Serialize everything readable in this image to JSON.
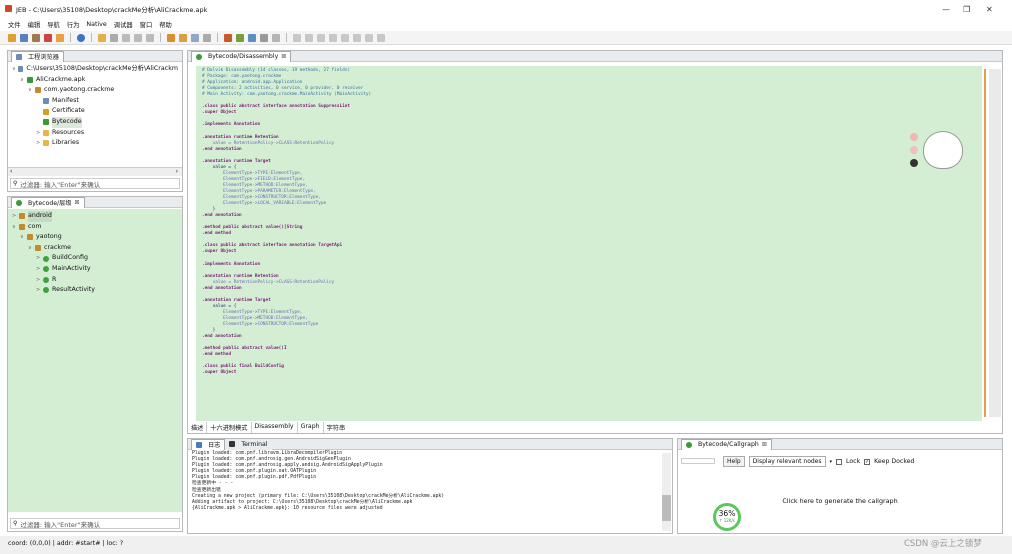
{
  "window": {
    "title": "JEB - C:\\Users\\35108\\Desktop\\crackMe分析\\AliCrackme.apk",
    "minimize": "—",
    "maximize": "❐",
    "close": "✕"
  },
  "menu": [
    "文件",
    "编辑",
    "导航",
    "行为",
    "Native",
    "调试器",
    "窗口",
    "帮助"
  ],
  "project_panel": {
    "tab": "工程浏览器",
    "items": [
      {
        "label": "C:\\Users\\35108\\Desktop\\crackMe分析\\AliCrackm",
        "depth": 0,
        "arrow": "∨"
      },
      {
        "label": "AliCrackme.apk",
        "depth": 1,
        "arrow": "∨"
      },
      {
        "label": "com.yaotong.crackme",
        "depth": 2,
        "arrow": "∨"
      },
      {
        "label": "Manifest",
        "depth": 3,
        "arrow": ""
      },
      {
        "label": "Certificate",
        "depth": 3,
        "arrow": ""
      },
      {
        "label": "Bytecode",
        "depth": 3,
        "arrow": ""
      },
      {
        "label": "Resources",
        "depth": 3,
        "arrow": ">"
      },
      {
        "label": "Libraries",
        "depth": 3,
        "arrow": ">"
      }
    ],
    "filter_placeholder": "过滤器: 输入\"Enter\"来确认"
  },
  "hierarchy_panel": {
    "tab": "Bytecode/层级",
    "items": [
      {
        "label": "android",
        "depth": 0,
        "arrow": ">"
      },
      {
        "label": "com",
        "depth": 0,
        "arrow": "∨"
      },
      {
        "label": "yaotong",
        "depth": 1,
        "arrow": "∨"
      },
      {
        "label": "crackme",
        "depth": 2,
        "arrow": "∨"
      },
      {
        "label": "BuildConfig",
        "depth": 3,
        "arrow": ">"
      },
      {
        "label": "MainActivity",
        "depth": 3,
        "arrow": ">"
      },
      {
        "label": "R",
        "depth": 3,
        "arrow": ">"
      },
      {
        "label": "ResultActivity",
        "depth": 3,
        "arrow": ">"
      }
    ],
    "filter_placeholder": "过滤器: 输入\"Enter\"来确认"
  },
  "editor": {
    "tab": "Bytecode/Disassembly",
    "bottom_tabs": [
      "描述",
      "十六进制模式",
      "Disassembly",
      "Graph",
      "字符串"
    ],
    "lines": [
      "# Dalvik Disassembly (14 classes, 19 methods, 27 fields)",
      "# Package: com.yaotong.crackme",
      "# Application: android.app.Application",
      "# Components: 2 activities, 0 service, 0 provider, 0 receiver",
      "# Main Activity: com.yaotong.crackme.MainActivity (MainActivity)",
      "",
      ".class public abstract interface annotation SuppressLint",
      ".super Object",
      "",
      ".implements Annotation",
      "",
      ".annotation runtime Retention",
      "    value = RetentionPolicy->CLASS:RetentionPolicy",
      ".end annotation",
      "",
      ".annotation runtime Target",
      "    value = {",
      "        ElementType->TYPE:ElementType,",
      "        ElementType->FIELD:ElementType,",
      "        ElementType->METHOD:ElementType,",
      "        ElementType->PARAMETER:ElementType,",
      "        ElementType->CONSTRUCTOR:ElementType,",
      "        ElementType->LOCAL_VARIABLE:ElementType",
      "    }",
      ".end annotation",
      "",
      ".method public abstract value()[String",
      ".end method",
      "",
      ".class public abstract interface annotation TargetApi",
      ".super Object",
      "",
      ".implements Annotation",
      "",
      ".annotation runtime Retention",
      "    value = RetentionPolicy->CLASS:RetentionPolicy",
      ".end annotation",
      "",
      ".annotation runtime Target",
      "    value = {",
      "        ElementType->TYPE:ElementType,",
      "        ElementType->METHOD:ElementType,",
      "        ElementType->CONSTRUCTOR:ElementType",
      "    }",
      ".end annotation",
      "",
      ".method public abstract value()I",
      ".end method",
      "",
      ".class public final BuildConfig",
      ".super Object"
    ]
  },
  "console": {
    "tabs": [
      "日志",
      "Terminal"
    ],
    "lines": [
      "Plugin loaded: com.pnf.libravm.LibraDecompilerPlugin",
      "Plugin loaded: com.pnf.androsig.gen.AndroidSigGenPlugin",
      "Plugin loaded: com.pnf.androsig.apply.andsig.AndroidSigApplyPlugin",
      "Plugin loaded: com.pnf.plugin.oat.OATPlugin",
      "Plugin loaded: com.pnf.plugin.pdf.PdfPlugin",
      "检查更新中 - - -",
      "检查更新出错",
      "Creating a new project (primary file: C:\\Users\\35108\\Desktop\\crackMe分析\\AliCrackme.apk)",
      "Adding artifact to project: C:\\Users\\35108\\Desktop\\crackMe分析\\AliCrackme.apk",
      "{AliCrackme.apk > AliCrackme.apk}: 10 resource files were adjusted"
    ]
  },
  "callgraph": {
    "tab": "Bytecode/Callgraph",
    "help": "Help",
    "select": "Display relevant nodes",
    "lock": "Lock",
    "keep_docked": "Keep Docked",
    "hint": "Click here to generate the callgraph",
    "gauge": "36%",
    "gauge_sub": "↑ 12K/s"
  },
  "status": {
    "text": "coord: (0,0,0) | addr: #start# | loc: ?",
    "watermark": "CSDN @云上之锁梦"
  },
  "colors": {
    "editor_bg": "#d4eed4",
    "accent": "#2b7a2b"
  }
}
